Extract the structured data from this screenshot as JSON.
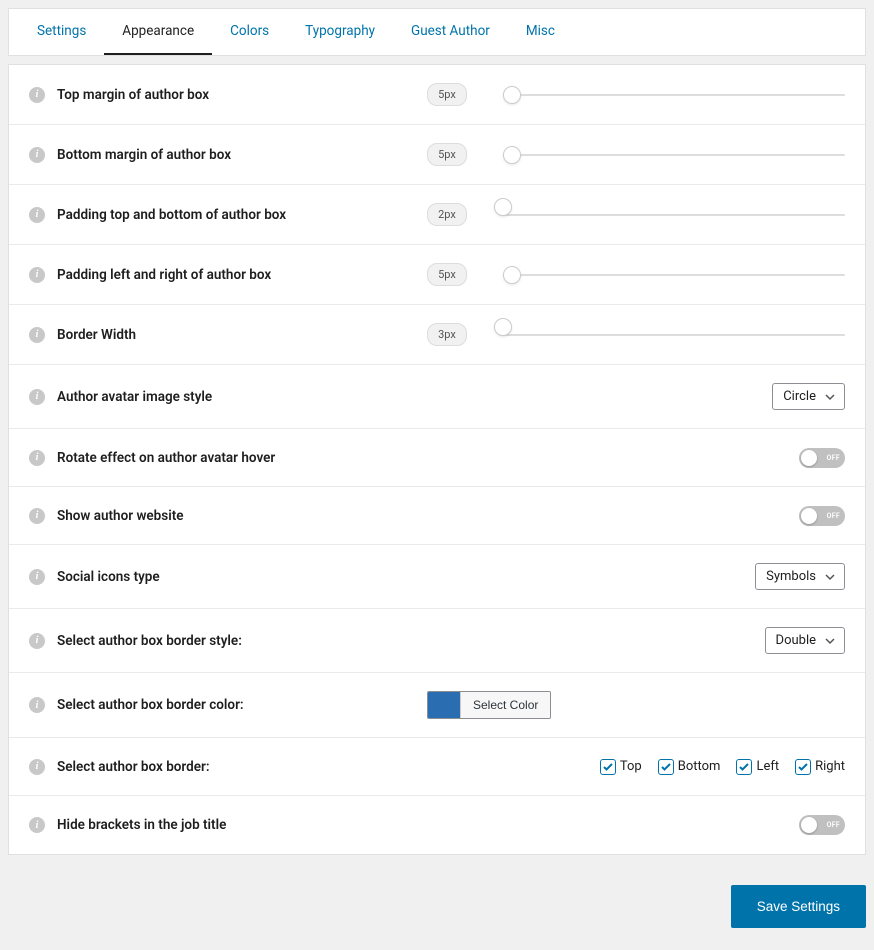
{
  "tabs": [
    {
      "label": "Settings",
      "active": false
    },
    {
      "label": "Appearance",
      "active": true
    },
    {
      "label": "Colors",
      "active": false
    },
    {
      "label": "Typography",
      "active": false
    },
    {
      "label": "Guest Author",
      "active": false
    },
    {
      "label": "Misc",
      "active": false
    }
  ],
  "settings": {
    "top_margin": {
      "label": "Top margin of author box",
      "value": "5px"
    },
    "bottom_margin": {
      "label": "Bottom margin of author box",
      "value": "5px"
    },
    "padding_tb": {
      "label": "Padding top and bottom of author box",
      "value": "2px"
    },
    "padding_lr": {
      "label": "Padding left and right of author box",
      "value": "5px"
    },
    "border_width": {
      "label": "Border Width",
      "value": "3px"
    },
    "avatar_style": {
      "label": "Author avatar image style",
      "value": "Circle"
    },
    "rotate_hover": {
      "label": "Rotate effect on author avatar hover",
      "value": "OFF"
    },
    "show_website": {
      "label": "Show author website",
      "value": "OFF"
    },
    "social_icons": {
      "label": "Social icons type",
      "value": "Symbols"
    },
    "border_style": {
      "label": "Select author box border style:",
      "value": "Double"
    },
    "border_color": {
      "label": "Select author box border color:",
      "button": "Select Color",
      "color": "#2a6db0"
    },
    "border_sides": {
      "label": "Select author box border:",
      "options": [
        {
          "label": "Top",
          "checked": true
        },
        {
          "label": "Bottom",
          "checked": true
        },
        {
          "label": "Left",
          "checked": true
        },
        {
          "label": "Right",
          "checked": true
        }
      ]
    },
    "hide_brackets": {
      "label": "Hide brackets in the job title",
      "value": "OFF"
    }
  },
  "footer": {
    "save": "Save Settings"
  }
}
